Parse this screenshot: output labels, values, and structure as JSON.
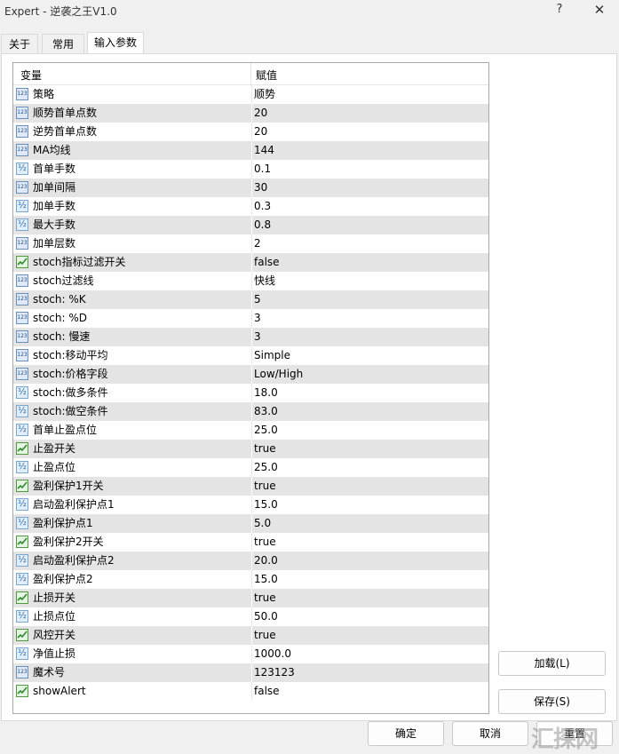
{
  "window": {
    "title": "Expert - 逆袭之王V1.0",
    "help_glyph": "?",
    "close_glyph": "✕"
  },
  "tabs": [
    {
      "label": "关于"
    },
    {
      "label": "常用"
    },
    {
      "label": "输入参数",
      "active": true
    }
  ],
  "table": {
    "headers": {
      "variable": "变量",
      "value": "赋值"
    },
    "rows": [
      {
        "type": "int",
        "name": "策略",
        "value": "顺势"
      },
      {
        "type": "int",
        "name": "顺势首单点数",
        "value": "20"
      },
      {
        "type": "int",
        "name": "逆势首单点数",
        "value": "20"
      },
      {
        "type": "int",
        "name": "MA均线",
        "value": "144"
      },
      {
        "type": "dbl",
        "name": "首单手数",
        "value": "0.1"
      },
      {
        "type": "int",
        "name": "加单间隔",
        "value": "30"
      },
      {
        "type": "dbl",
        "name": "加单手数",
        "value": "0.3"
      },
      {
        "type": "dbl",
        "name": "最大手数",
        "value": "0.8"
      },
      {
        "type": "int",
        "name": "加单层数",
        "value": "2"
      },
      {
        "type": "bool",
        "name": "stoch指标过滤开关",
        "value": "false"
      },
      {
        "type": "int",
        "name": "stoch过滤线",
        "value": "快线"
      },
      {
        "type": "int",
        "name": "stoch: %K",
        "value": "5"
      },
      {
        "type": "int",
        "name": "stoch: %D",
        "value": "3"
      },
      {
        "type": "int",
        "name": "stoch: 慢速",
        "value": "3"
      },
      {
        "type": "int",
        "name": "stoch:移动平均",
        "value": "Simple"
      },
      {
        "type": "int",
        "name": "stoch:价格字段",
        "value": "Low/High"
      },
      {
        "type": "dbl",
        "name": "stoch:做多条件",
        "value": "18.0"
      },
      {
        "type": "dbl",
        "name": "stoch:做空条件",
        "value": "83.0"
      },
      {
        "type": "dbl",
        "name": "首单止盈点位",
        "value": "25.0"
      },
      {
        "type": "bool",
        "name": "止盈开关",
        "value": "true"
      },
      {
        "type": "dbl",
        "name": "止盈点位",
        "value": "25.0"
      },
      {
        "type": "bool",
        "name": "盈利保护1开关",
        "value": "true"
      },
      {
        "type": "dbl",
        "name": "启动盈利保护点1",
        "value": "15.0"
      },
      {
        "type": "dbl",
        "name": "盈利保护点1",
        "value": "5.0"
      },
      {
        "type": "bool",
        "name": "盈利保护2开关",
        "value": "true"
      },
      {
        "type": "dbl",
        "name": "启动盈利保护点2",
        "value": "20.0"
      },
      {
        "type": "dbl",
        "name": "盈利保护点2",
        "value": "15.0"
      },
      {
        "type": "bool",
        "name": "止损开关",
        "value": "true"
      },
      {
        "type": "dbl",
        "name": "止损点位",
        "value": "50.0"
      },
      {
        "type": "bool",
        "name": "风控开关",
        "value": "true"
      },
      {
        "type": "dbl",
        "name": "净值止损",
        "value": "1000.0"
      },
      {
        "type": "int",
        "name": "魔术号",
        "value": "123123"
      },
      {
        "type": "bool",
        "name": "showAlert",
        "value": "false"
      }
    ]
  },
  "side_buttons": {
    "load": "加载(L)",
    "save": "保存(S)"
  },
  "bottom_buttons": {
    "ok": "确定",
    "cancel": "取消",
    "reset": "重置"
  },
  "watermark": "汇探网"
}
